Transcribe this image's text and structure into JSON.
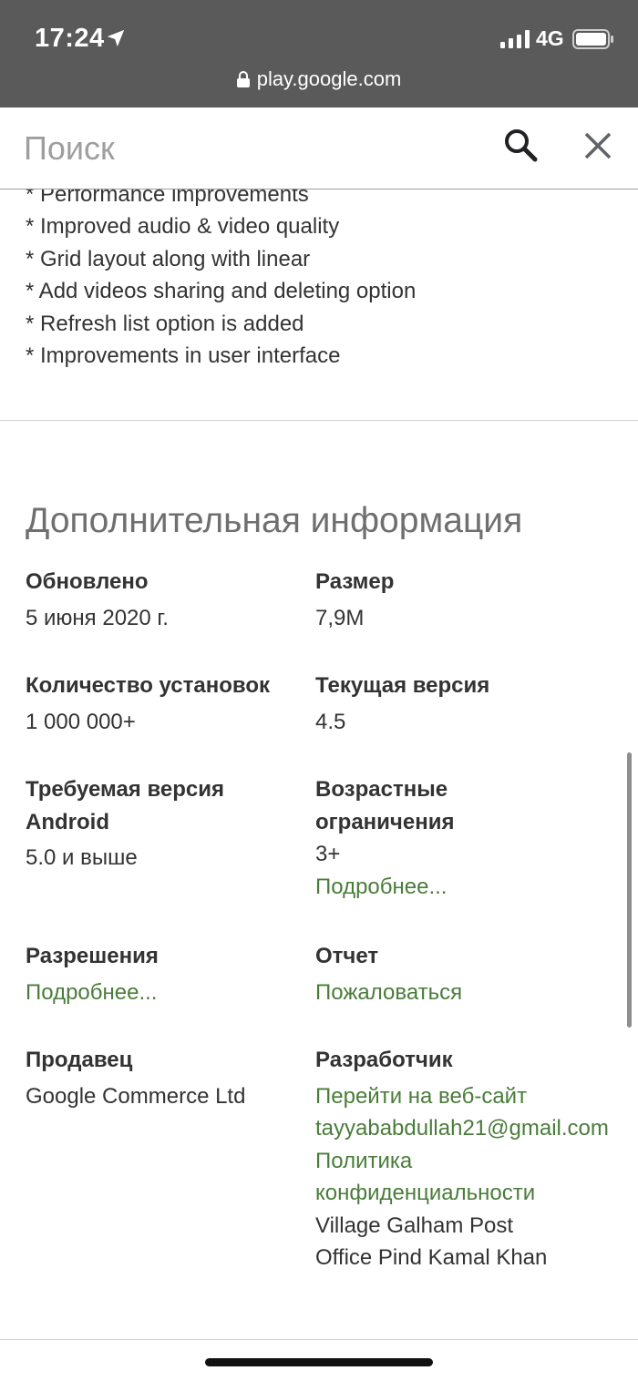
{
  "status_bar": {
    "time": "17:24",
    "network": "4G",
    "url": "play.google.com"
  },
  "search": {
    "placeholder": "Поиск"
  },
  "changelog": [
    "* Performance improvements",
    "* Improved audio & video quality",
    "* Grid layout along with linear",
    "* Add videos sharing and deleting option",
    "* Refresh list option is added",
    "* Improvements in user interface"
  ],
  "additional_info": {
    "title": "Дополнительная информация",
    "updated": {
      "label": "Обновлено",
      "value": "5 июня 2020 г."
    },
    "size": {
      "label": "Размер",
      "value": "7,9M"
    },
    "installs": {
      "label": "Количество установок",
      "value": "1 000 000+"
    },
    "current_version": {
      "label": "Текущая версия",
      "value": "4.5"
    },
    "required_android": {
      "label_line1": "Требуемая версия",
      "label_line2": "Android",
      "value": "5.0 и выше"
    },
    "age_rating": {
      "label_line1": "Возрастные",
      "label_line2": "ограничения",
      "value": "3+",
      "link": "Подробнее..."
    },
    "permissions": {
      "label": "Разрешения",
      "link": "Подробнее..."
    },
    "report": {
      "label": "Отчет",
      "link": "Пожаловаться"
    },
    "seller": {
      "label": "Продавец",
      "value": "Google Commerce Ltd"
    },
    "developer": {
      "label": "Разработчик",
      "website": "Перейти на веб-сайт",
      "email": "tayyababdullah21@gmail.com",
      "privacy_line1": "Политика",
      "privacy_line2": "конфиденциальности",
      "address_line1": "Village Galham Post",
      "address_line2": "Office Pind Kamal Khan"
    }
  },
  "colors": {
    "link": "#4a7c3a",
    "status_bar_bg": "#5a5a5a",
    "title_gray": "#6f6f6f"
  }
}
